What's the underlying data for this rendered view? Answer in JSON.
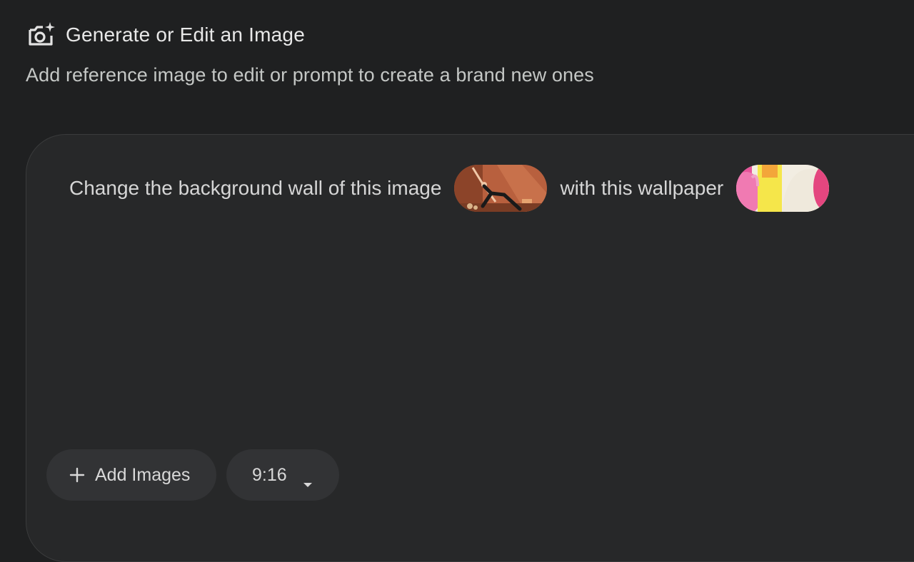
{
  "header": {
    "icon": "camera-sparkle-icon",
    "title": "Generate or Edit an Image",
    "subtitle": "Add reference image to edit or prompt to create a brand new ones"
  },
  "prompt": {
    "text_part_1": "Change the background wall of this image",
    "image_1": "yoga-pose-photo-thumbnail",
    "text_part_2": "with this wallpaper",
    "image_2": "colorful-wallpaper-thumbnail"
  },
  "controls": {
    "add_images_label": "Add Images",
    "add_images_icon": "plus-icon",
    "aspect_ratio_value": "9:16",
    "aspect_ratio_icon": "caret-down-icon"
  },
  "colors": {
    "background": "#1f2021",
    "card": "#272829",
    "pill": "#323335",
    "text": "#e3e3e3"
  }
}
